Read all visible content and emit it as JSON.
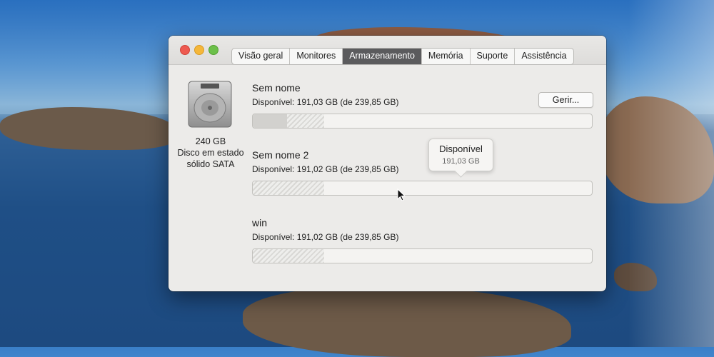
{
  "window": {
    "tabs": [
      {
        "label": "Visão geral",
        "active": false
      },
      {
        "label": "Monitores",
        "active": false
      },
      {
        "label": "Armazenamento",
        "active": true
      },
      {
        "label": "Memória",
        "active": false
      },
      {
        "label": "Suporte",
        "active": false
      },
      {
        "label": "Assistência",
        "active": false
      }
    ]
  },
  "disk": {
    "icon": "hard-drive-icon",
    "size": "240 GB",
    "type_line1": "Disco em estado",
    "type_line2": "sólido SATA"
  },
  "manage_button": "Gerir...",
  "volumes": [
    {
      "name": "Sem nome",
      "available": "Disponível: 191,03 GB (de 239,85 GB)",
      "used_fraction": 0.1,
      "other_fraction": 0.11
    },
    {
      "name": "Sem nome 2",
      "available": "Disponível: 191,02 GB (de 239,85 GB)",
      "used_fraction": 0.0,
      "other_fraction": 0.21
    },
    {
      "name": "win",
      "available": "Disponível: 191,02 GB (de 239,85 GB)",
      "used_fraction": 0.0,
      "other_fraction": 0.21
    }
  ],
  "tooltip": {
    "title": "Disponível",
    "value": "191,03 GB"
  },
  "colors": {
    "active_tab": "#5b5b5d",
    "window_bg": "#ecebe9"
  }
}
